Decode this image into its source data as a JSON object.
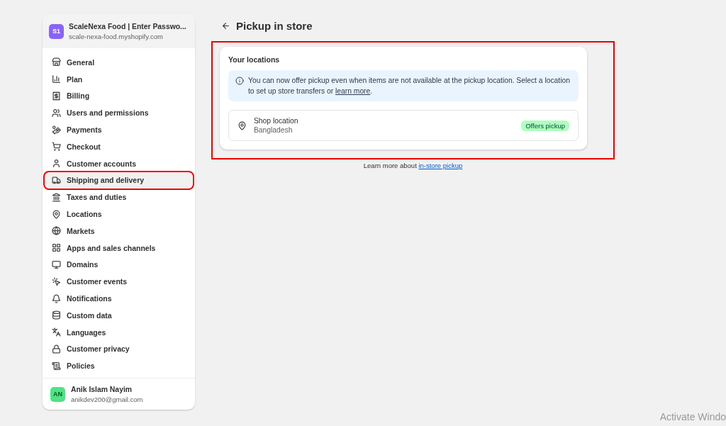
{
  "store": {
    "avatar": "S1",
    "name": "ScaleNexa Food | Enter Passwo...",
    "domain": "scale-nexa-food.myshopify.com"
  },
  "sidebar": {
    "items": [
      {
        "label": "General",
        "selected": false,
        "highlighted": false
      },
      {
        "label": "Plan",
        "selected": false,
        "highlighted": false
      },
      {
        "label": "Billing",
        "selected": false,
        "highlighted": false
      },
      {
        "label": "Users and permissions",
        "selected": false,
        "highlighted": false
      },
      {
        "label": "Payments",
        "selected": false,
        "highlighted": false
      },
      {
        "label": "Checkout",
        "selected": false,
        "highlighted": false
      },
      {
        "label": "Customer accounts",
        "selected": false,
        "highlighted": false
      },
      {
        "label": "Shipping and delivery",
        "selected": true,
        "highlighted": true
      },
      {
        "label": "Taxes and duties",
        "selected": false,
        "highlighted": false
      },
      {
        "label": "Locations",
        "selected": false,
        "highlighted": false
      },
      {
        "label": "Markets",
        "selected": false,
        "highlighted": false
      },
      {
        "label": "Apps and sales channels",
        "selected": false,
        "highlighted": false
      },
      {
        "label": "Domains",
        "selected": false,
        "highlighted": false
      },
      {
        "label": "Customer events",
        "selected": false,
        "highlighted": false
      },
      {
        "label": "Notifications",
        "selected": false,
        "highlighted": false
      },
      {
        "label": "Custom data",
        "selected": false,
        "highlighted": false
      },
      {
        "label": "Languages",
        "selected": false,
        "highlighted": false
      },
      {
        "label": "Customer privacy",
        "selected": false,
        "highlighted": false
      },
      {
        "label": "Policies",
        "selected": false,
        "highlighted": false
      }
    ]
  },
  "user": {
    "avatar": "AN",
    "name": "Anik Islam Nayim",
    "email": "anikdev200@gmail.com"
  },
  "page": {
    "title": "Pickup in store"
  },
  "locations_card": {
    "highlighted": true,
    "title": "Your locations",
    "banner": {
      "text": "You can now offer pickup even when items are not available at the pickup location. Select a location to set up store transfers or ",
      "link": "learn more",
      "end": "."
    },
    "locations": [
      {
        "name": "Shop location",
        "country": "Bangladesh",
        "badge": "Offers pickup"
      }
    ]
  },
  "footer": {
    "text": "Learn more about ",
    "link": "in-store pickup"
  },
  "os_notice": "Activate Windo"
}
